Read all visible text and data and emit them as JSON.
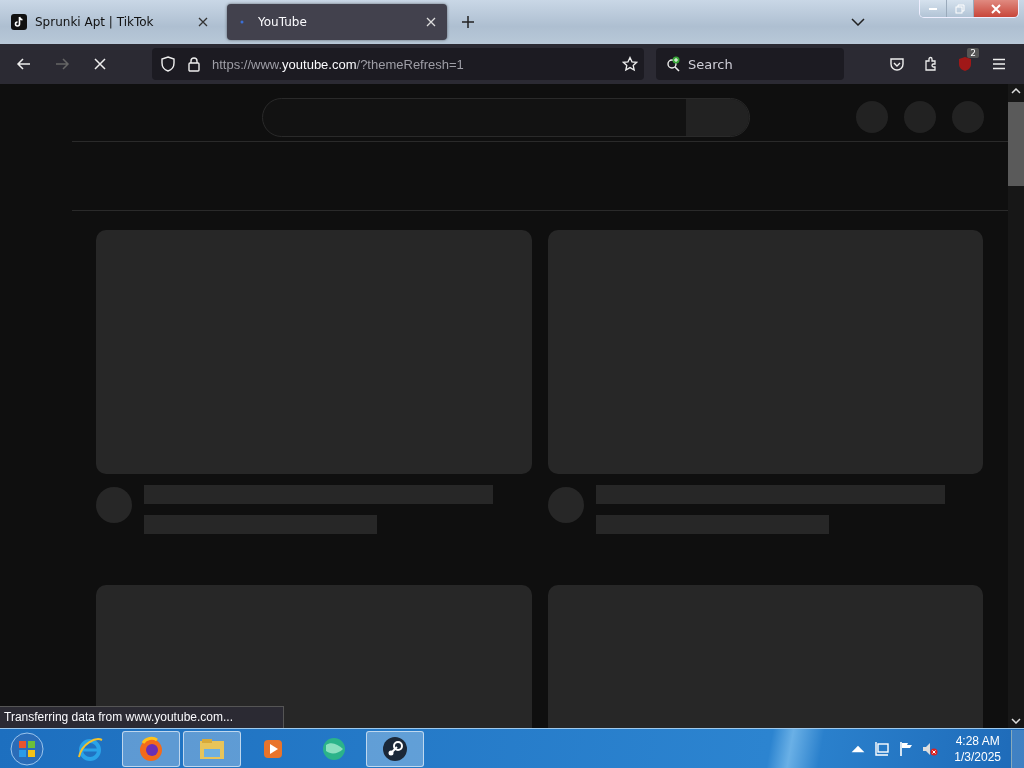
{
  "tabs": [
    {
      "title": "Sprunki Apt | TikTok",
      "selected": false,
      "kind": "tiktok"
    },
    {
      "title": "YouTube",
      "selected": true,
      "kind": "loading"
    }
  ],
  "nav": {
    "back_disabled": false,
    "forward_disabled": true,
    "loading": true
  },
  "url": {
    "prefix": "https://www.",
    "host": "youtube.com",
    "path": "/?themeRefresh=1"
  },
  "search": {
    "placeholder": "Search"
  },
  "extension_badge": "2",
  "page_header": {
    "button_placeholders": [
      {
        "kind": "circle"
      },
      {
        "kind": "circle"
      },
      {
        "kind": "circle"
      }
    ]
  },
  "video_grid": [
    {
      "kind": "skeleton"
    },
    {
      "kind": "skeleton"
    },
    {
      "kind": "thumbnail_only"
    },
    {
      "kind": "thumbnail_only"
    }
  ],
  "status_text": "Transferring data from www.youtube.com...",
  "taskbar": [
    {
      "kind": "ie",
      "open": false
    },
    {
      "kind": "firefox",
      "open": true
    },
    {
      "kind": "explorer",
      "open": true
    },
    {
      "kind": "media",
      "open": false
    },
    {
      "kind": "sphere",
      "open": false
    },
    {
      "kind": "steam",
      "open": true
    }
  ],
  "clock": {
    "time": "4:28 AM",
    "date": "1/3/2025"
  }
}
